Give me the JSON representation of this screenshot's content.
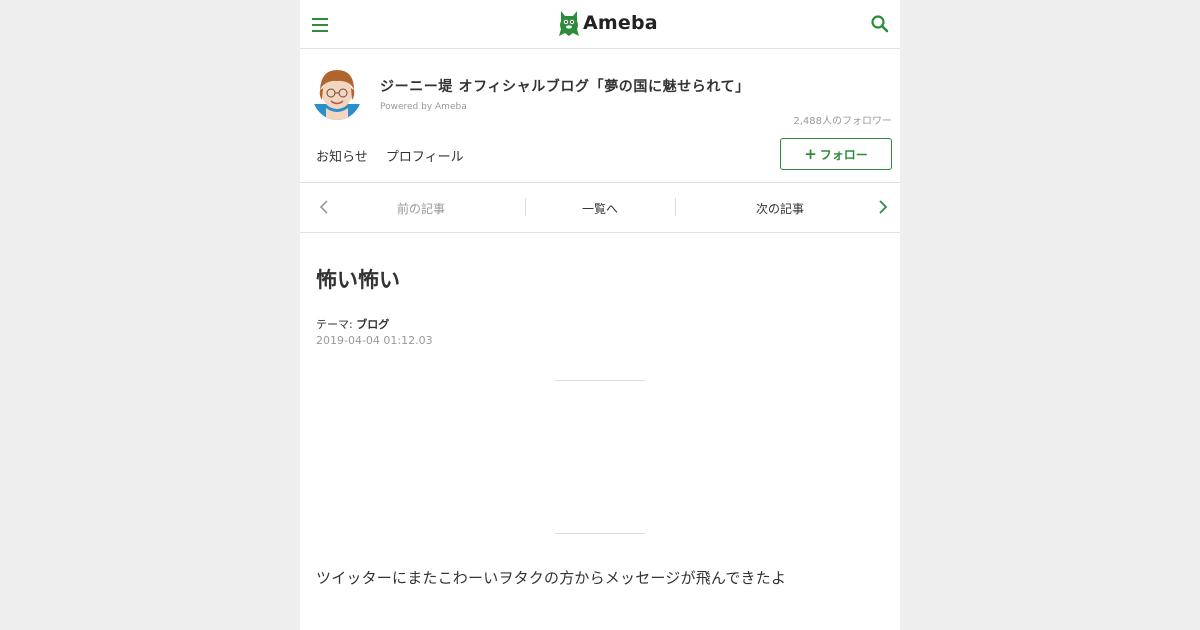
{
  "header": {
    "logo_text": "Ameba",
    "menu_icon": "hamburger-menu-icon",
    "search_icon": "search-icon",
    "accent_color": "#2d8c3c"
  },
  "blog": {
    "title": "ジーニー堤 オフィシャルブログ「夢の国に魅せられて」",
    "powered_by": "Powered by Ameba",
    "followers": "2,488人のフォロワー",
    "nav": [
      "お知らせ",
      "プロフィール"
    ],
    "follow_label": "フォロー"
  },
  "pager": {
    "prev": "前の記事",
    "list": "一覧へ",
    "next": "次の記事"
  },
  "entry": {
    "title": "怖い怖い",
    "theme_label": "テーマ:",
    "theme_value": "ブログ",
    "date": "2019-04-04 01:12.03",
    "body": "ツイッターにまたこわーいヲタクの方からメッセージが飛んできたよ"
  }
}
